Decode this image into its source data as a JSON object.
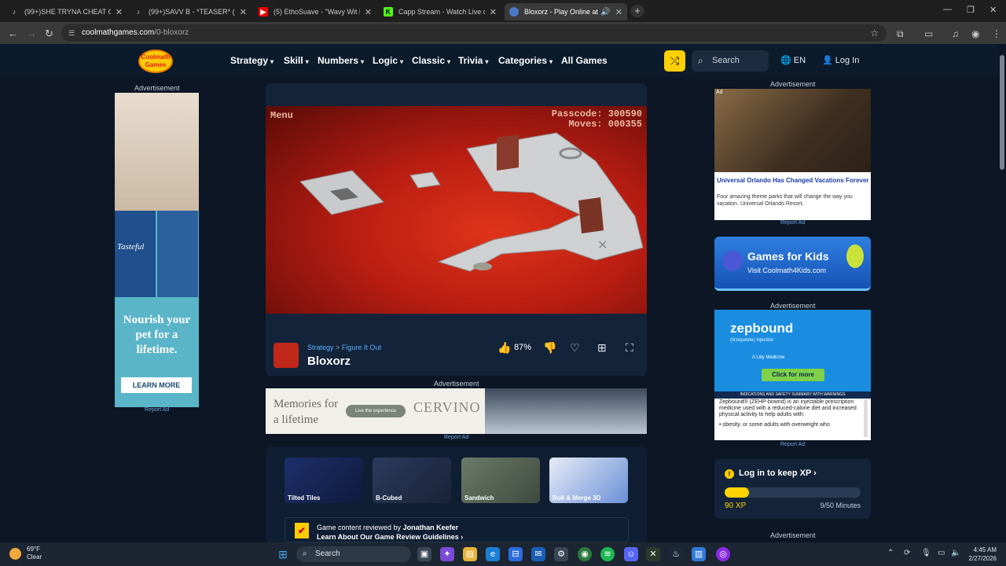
{
  "browser": {
    "tabs": [
      {
        "title": "(99+)SHE TRYNA CHEAT ON B!",
        "favicon": "tiktok-icon"
      },
      {
        "title": "(99+)SAVV B - *TEASER* (Offici",
        "favicon": "tiktok-icon"
      },
      {
        "title": "(5) EthoSuave - \"Wavy Wit Nun",
        "favicon": "youtube-icon"
      },
      {
        "title": "Capp Stream - Watch Live on K",
        "favicon": "kick-icon"
      },
      {
        "title": "Bloxorz - Play Online at Cc",
        "favicon": "coolmath-icon"
      }
    ],
    "url_site": "coolmathgames.com",
    "url_path": "/0-bloxorz"
  },
  "site": {
    "logo": "Coolmath Games",
    "nav": [
      "Strategy",
      "Skill",
      "Numbers",
      "Logic",
      "Classic",
      "Trivia",
      "Categories",
      "All Games"
    ],
    "search_placeholder": "Search",
    "lang": "EN",
    "login": "Log In"
  },
  "ads": {
    "label": "Advertisement",
    "report": "Report Ad",
    "left": {
      "brand": "Tasteful",
      "text": "Nourish your pet for a lifetime.",
      "cta": "LEARN MORE"
    },
    "bottom": {
      "headline": "Memories for a lifetime",
      "pill": "Live the experience",
      "brand": "CERVINO"
    },
    "right_top": {
      "tag": "Ad",
      "title": "Universal Orlando Has Changed Vacations Forever",
      "desc": "Four amazing theme parks that will change the way you vacation. Universal Orlando Resort."
    },
    "kids": {
      "title": "Games for Kids",
      "sub": "Visit Coolmath4Kids.com"
    },
    "zep": {
      "logo": "zepbound",
      "sub": "(tirzepatide) injection",
      "lilly": "A Lilly Medicine",
      "cta": "Click for more",
      "warning": "INDICATIONS AND SAFETY SUMMARY WITH WARNINGS",
      "body": "Zepbound® (ZEHP-bownd) is an injectable prescription medicine used with a reduced-calorie diet and increased physical activity to help adults with:",
      "bullet": "obesity, or some adults with overweight who"
    }
  },
  "game": {
    "menu": "Menu",
    "passcode_label": "Passcode:",
    "passcode": "300590",
    "moves_label": "Moves:",
    "moves": "000355",
    "breadcrumb_cat": "Strategy",
    "breadcrumb_sep": ">",
    "breadcrumb_sub": "Figure It Out",
    "title": "Bloxorz",
    "rating": "87%"
  },
  "related": [
    {
      "name": "Tilted Tiles"
    },
    {
      "name": "B-Cubed"
    },
    {
      "name": "Sandwich"
    },
    {
      "name": "Roll & Merge 3D"
    }
  ],
  "review": {
    "line1_prefix": "Game content reviewed by ",
    "reviewer": "Jonathan Keefer",
    "line2": "Learn About Our Game Review Guidelines"
  },
  "xp": {
    "title": "Log in to keep XP",
    "xp": "90 XP",
    "minutes": "9/50 Minutes",
    "progress": 0.18
  },
  "taskbar": {
    "temp": "69°F",
    "cond": "Clear",
    "search": "Search",
    "time": "4:45 AM",
    "date": "2/27/2026"
  }
}
